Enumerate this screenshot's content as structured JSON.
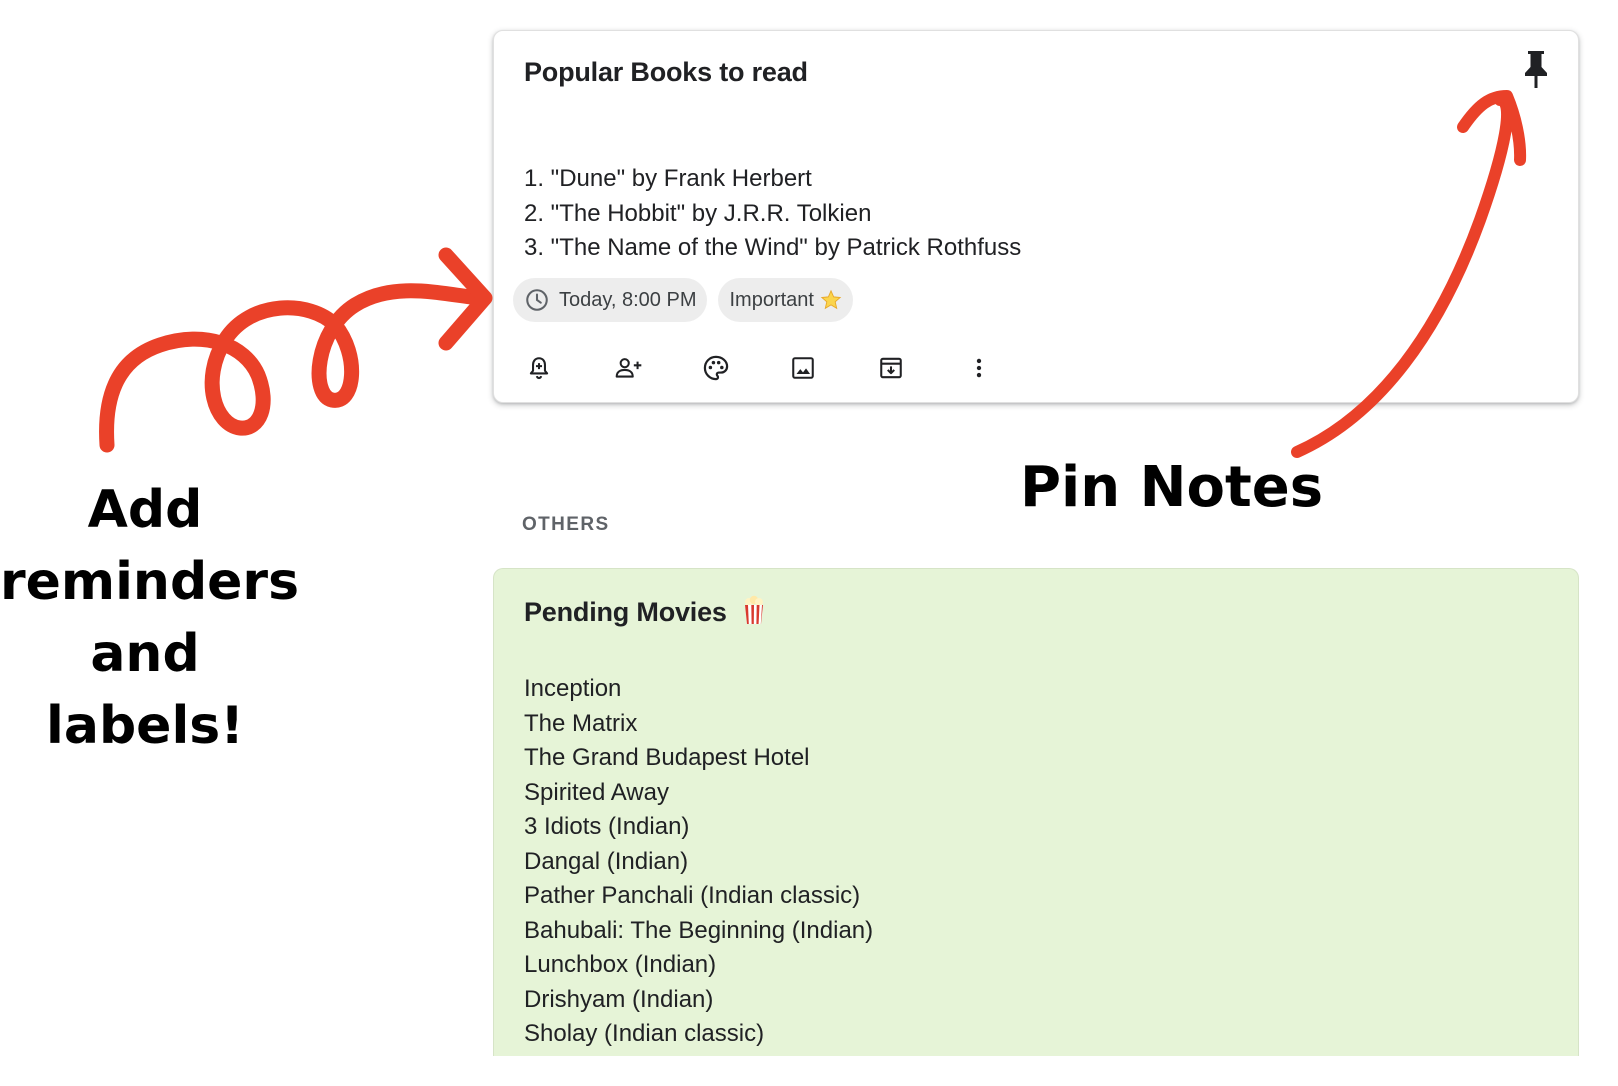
{
  "pinned_note": {
    "title": "Popular Books to read",
    "items": [
      "1. \"Dune\" by Frank Herbert",
      "2. \"The Hobbit\" by J.R.R. Tolkien",
      "3. \"The Name of the Wind\" by Patrick Rothfuss"
    ],
    "reminder_chip": "Today, 8:00 PM",
    "label_chip": "Important",
    "pin_icon": "pin-icon",
    "toolbar_icons": [
      "bell-plus-icon",
      "person-add-icon",
      "palette-icon",
      "image-icon",
      "archive-icon",
      "more-vert-icon"
    ]
  },
  "section": {
    "label": "OTHERS"
  },
  "other_note": {
    "title": "Pending Movies",
    "title_emoji": "popcorn-icon",
    "background_color": "#e6f4d7",
    "items": [
      "Inception",
      "The Matrix",
      "The Grand Budapest Hotel",
      "Spirited Away",
      "3 Idiots (Indian)",
      "Dangal (Indian)",
      "Pather Panchali (Indian classic)",
      "Bahubali: The Beginning (Indian)",
      "Lunchbox (Indian)",
      "Drishyam (Indian)",
      "Sholay (Indian classic)"
    ]
  },
  "annotations": {
    "left_lines": [
      "Add",
      "reminders",
      "and labels!"
    ],
    "right": "Pin Notes",
    "arrow_color": "#ea4129"
  }
}
